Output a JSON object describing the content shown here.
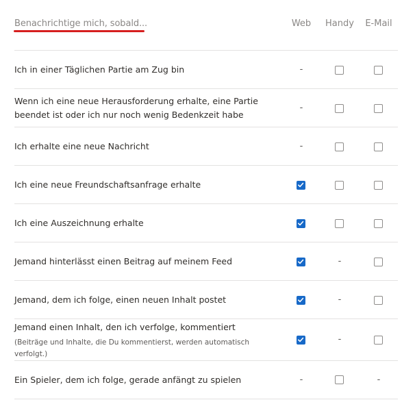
{
  "header": {
    "title": "Benachrichtige mich, sobald...",
    "columns": {
      "web": "Web",
      "mobile": "Handy",
      "email": "E-Mail"
    }
  },
  "rows": [
    {
      "label": "Ich in einer Täglichen Partie am Zug bin",
      "web": "-",
      "mobile": "unchecked",
      "email": "unchecked"
    },
    {
      "label_line1": "Wenn ich eine neue Herausforderung erhalte, eine Partie",
      "label_line2": "beendet ist oder ich nur noch wenig Bedenkzeit habe",
      "web": "-",
      "mobile": "unchecked",
      "email": "unchecked"
    },
    {
      "label": "Ich erhalte eine neue Nachricht",
      "web": "-",
      "mobile": "unchecked",
      "email": "unchecked"
    },
    {
      "label": "Ich eine neue Freundschaftsanfrage erhalte",
      "web": "checked",
      "mobile": "unchecked",
      "email": "unchecked"
    },
    {
      "label": "Ich eine Auszeichnung erhalte",
      "web": "checked",
      "mobile": "unchecked",
      "email": "unchecked"
    },
    {
      "label": "Jemand hinterlässt einen Beitrag auf meinem Feed",
      "web": "checked",
      "mobile": "-",
      "email": "unchecked"
    },
    {
      "label": "Jemand, dem ich folge, einen neuen Inhalt postet",
      "web": "checked",
      "mobile": "-",
      "email": "unchecked"
    },
    {
      "label": "Jemand einen Inhalt, den ich verfolge, kommentiert",
      "note_line1": "(Beiträge und Inhalte, die Du kommentierst, werden automatisch",
      "note_line2": "verfolgt.)",
      "web": "checked",
      "mobile": "-",
      "email": "unchecked"
    },
    {
      "label": "Ein Spieler, dem ich folge, gerade anfängt zu spielen",
      "web": "-",
      "mobile": "unchecked",
      "email": "-"
    }
  ],
  "colors": {
    "accent_underline": "#d61f1f",
    "checkbox_checked": "#1769c8"
  }
}
